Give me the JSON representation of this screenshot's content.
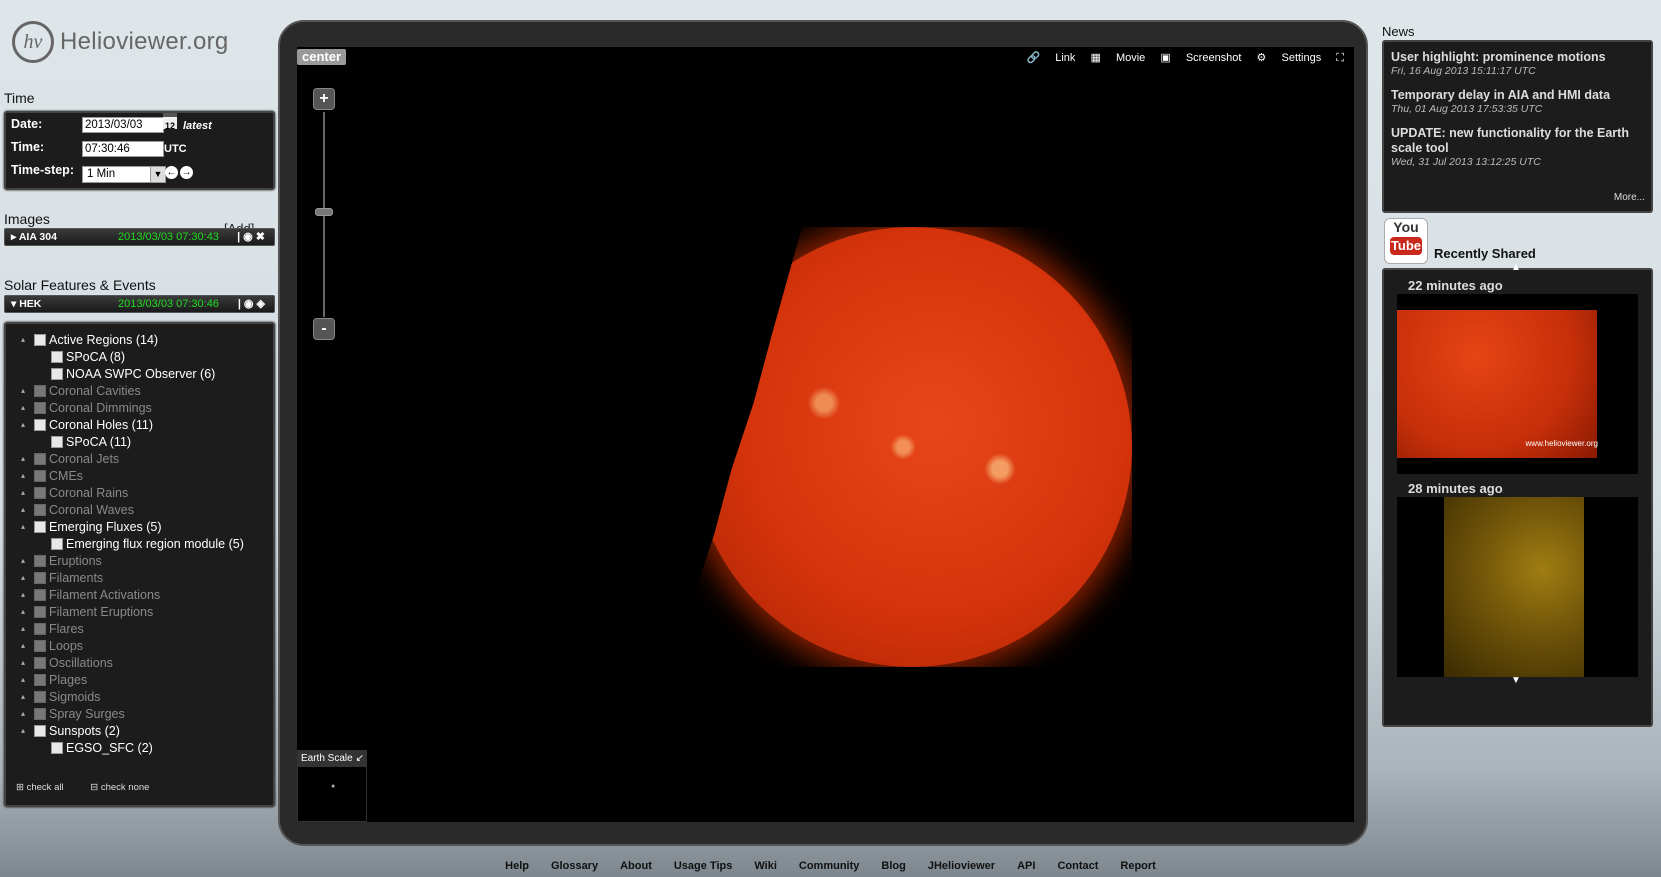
{
  "logo": {
    "mark": "hv",
    "text": "Helioviewer.org"
  },
  "time": {
    "title": "Time",
    "date_label": "Date:",
    "date_value": "2013/03/03",
    "calendar_icon_text": "12",
    "latest_label": "latest",
    "time_label": "Time:",
    "time_value": "07:30:46",
    "utc_label": "UTC",
    "step_label": "Time-step:",
    "step_value": "1 Min"
  },
  "images": {
    "title": "Images",
    "add_label": "[Add]",
    "layer": {
      "name": "AIA 304",
      "timestamp": "2013/03/03 07:30:43"
    }
  },
  "features": {
    "title": "Solar Features & Events",
    "layer": {
      "name": "HEK",
      "timestamp": "2013/03/03 07:30:46"
    },
    "items": [
      {
        "label": "Active Regions (14)",
        "active": true,
        "indent": 0
      },
      {
        "label": "SPoCA (8)",
        "active": true,
        "indent": 1
      },
      {
        "label": "NOAA SWPC Observer (6)",
        "active": true,
        "indent": 1
      },
      {
        "label": "Coronal Cavities",
        "active": false,
        "indent": 0
      },
      {
        "label": "Coronal Dimmings",
        "active": false,
        "indent": 0
      },
      {
        "label": "Coronal Holes (11)",
        "active": true,
        "indent": 0
      },
      {
        "label": "SPoCA (11)",
        "active": true,
        "indent": 1
      },
      {
        "label": "Coronal Jets",
        "active": false,
        "indent": 0
      },
      {
        "label": "CMEs",
        "active": false,
        "indent": 0
      },
      {
        "label": "Coronal Rains",
        "active": false,
        "indent": 0
      },
      {
        "label": "Coronal Waves",
        "active": false,
        "indent": 0
      },
      {
        "label": "Emerging Fluxes (5)",
        "active": true,
        "indent": 0
      },
      {
        "label": "Emerging flux region module (5)",
        "active": true,
        "indent": 1
      },
      {
        "label": "Eruptions",
        "active": false,
        "indent": 0
      },
      {
        "label": "Filaments",
        "active": false,
        "indent": 0
      },
      {
        "label": "Filament Activations",
        "active": false,
        "indent": 0
      },
      {
        "label": "Filament Eruptions",
        "active": false,
        "indent": 0
      },
      {
        "label": "Flares",
        "active": false,
        "indent": 0
      },
      {
        "label": "Loops",
        "active": false,
        "indent": 0
      },
      {
        "label": "Oscillations",
        "active": false,
        "indent": 0
      },
      {
        "label": "Plages",
        "active": false,
        "indent": 0
      },
      {
        "label": "Sigmoids",
        "active": false,
        "indent": 0
      },
      {
        "label": "Spray Surges",
        "active": false,
        "indent": 0
      },
      {
        "label": "Sunspots (2)",
        "active": true,
        "indent": 0
      },
      {
        "label": "EGSO_SFC (2)",
        "active": true,
        "indent": 1
      }
    ],
    "check_all": "check all",
    "check_none": "check none"
  },
  "viewport": {
    "center_label": "center",
    "link_label": "Link",
    "movie_label": "Movie",
    "screenshot_label": "Screenshot",
    "settings_label": "Settings",
    "zoom_in": "+",
    "zoom_out": "-",
    "earth_scale_label": "Earth Scale"
  },
  "news": {
    "title": "News",
    "items": [
      {
        "title": "User highlight: prominence motions",
        "date": "Fri, 16 Aug 2013 15:11:17 UTC"
      },
      {
        "title": "Temporary delay in AIA and HMI data",
        "date": "Thu, 01 Aug 2013 17:53:35 UTC"
      },
      {
        "title": "UPDATE: new functionality for the Earth scale tool",
        "date": "Wed, 31 Jul 2013 13:12:25 UTC"
      }
    ],
    "more_label": "More..."
  },
  "recent": {
    "yt_top": "You",
    "yt_bottom": "Tube",
    "title": "Recently Shared",
    "items": [
      {
        "age": "22 minutes ago",
        "watermark": "www.helioviewer.org"
      },
      {
        "age": "28 minutes ago",
        "watermark": ""
      }
    ]
  },
  "footer": [
    "Help",
    "Glossary",
    "About",
    "Usage Tips",
    "Wiki",
    "Community",
    "Blog",
    "JHelioviewer",
    "API",
    "Contact",
    "Report"
  ],
  "colors": {
    "timestamp_green": "#1fdc1f",
    "panel_dark": "#1c1c1c",
    "sun_red": "#d5330b"
  }
}
